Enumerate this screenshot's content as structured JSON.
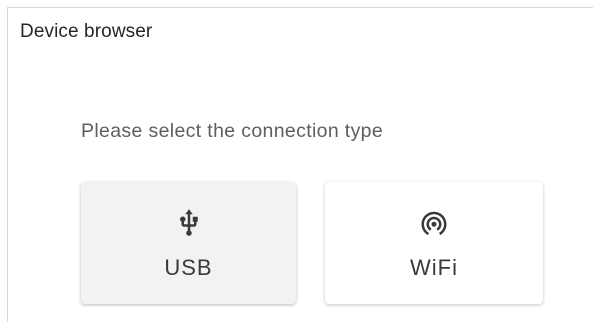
{
  "panel": {
    "title": "Device browser"
  },
  "connection": {
    "prompt": "Please select the connection type",
    "options": [
      {
        "label": "USB",
        "icon": "usb-icon"
      },
      {
        "label": "WiFi",
        "icon": "wifi-tethering-icon"
      }
    ]
  },
  "colors": {
    "text_primary": "#262626",
    "text_secondary": "#5e5e5e",
    "usb_button_bg": "#f2f2f2",
    "wifi_button_bg": "#ffffff",
    "icon": "#3a3a3a"
  }
}
